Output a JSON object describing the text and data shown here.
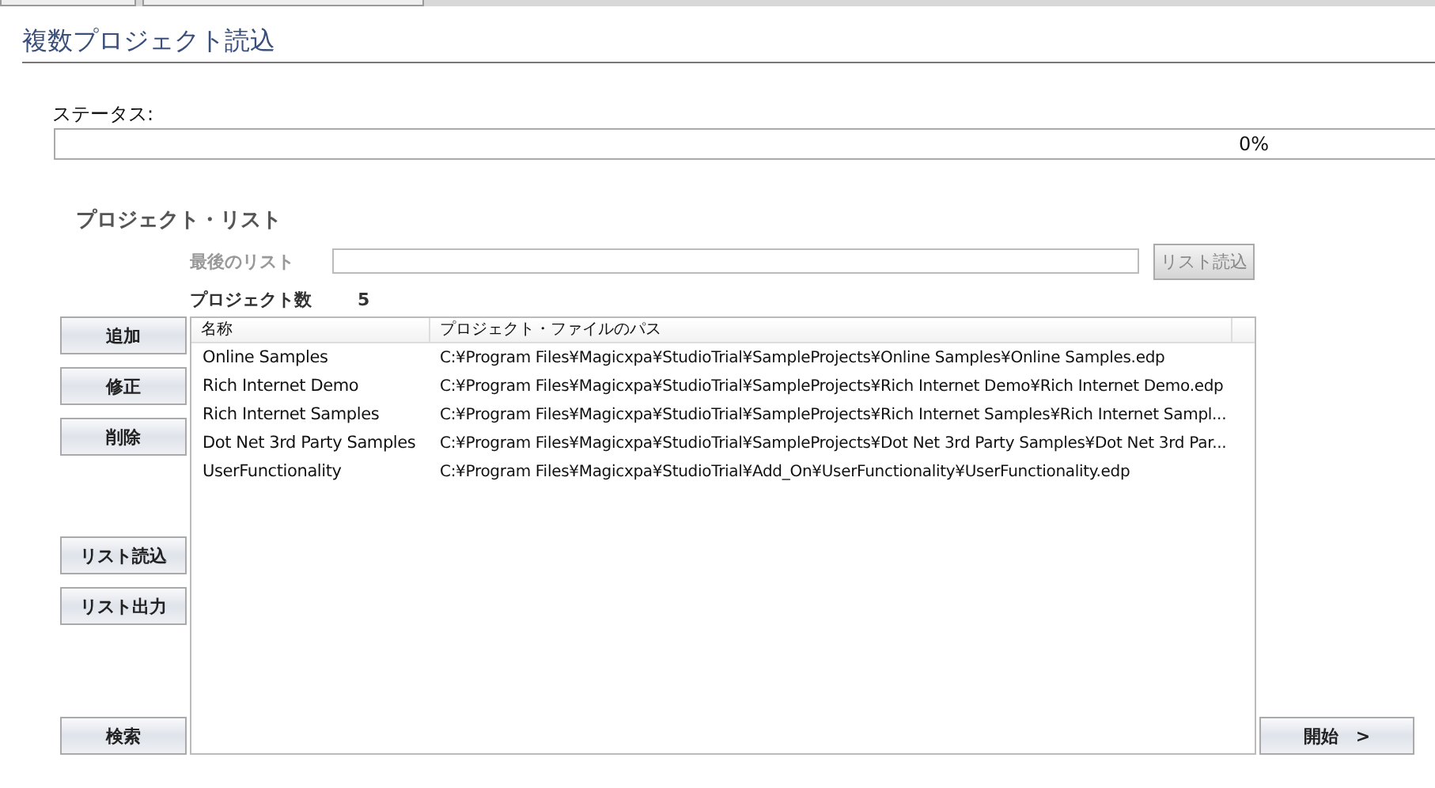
{
  "window": {
    "title": "複数プロジェクト読込"
  },
  "status": {
    "label": "ステータス:",
    "level": 0,
    "reading": "0%"
  },
  "project_list": {
    "title": "プロジェクト・リスト",
    "last_list": {
      "label": "最後のリスト",
      "disabled": true,
      "button": "リスト読込"
    },
    "count": {
      "label": "プロジェクト数",
      "value": "5"
    },
    "edit_buttons": [
      "追加",
      "修正",
      "削除"
    ],
    "list_buttons": [
      "リスト読込",
      "リスト出力"
    ],
    "search_button": "検索",
    "table": {
      "columns": [
        "名称",
        "プロジェクト・ファイルのパス"
      ],
      "rows": [
        {
          "name": "Online Samples",
          "path": "C:¥Program Files¥Magicxpa¥StudioTrial¥SampleProjects¥Online Samples¥Online Samples.edp"
        },
        {
          "name": "Rich Internet Demo",
          "path": "C:¥Program Files¥Magicxpa¥StudioTrial¥SampleProjects¥Rich Internet Demo¥Rich Internet Demo.edp"
        },
        {
          "name": "Rich Internet Samples",
          "path": "C:¥Program Files¥Magicxpa¥StudioTrial¥SampleProjects¥Rich Internet Samples¥Rich Internet Sampl..."
        },
        {
          "name": "Dot Net 3rd Party Samples",
          "path": "C:¥Program Files¥Magicxpa¥StudioTrial¥SampleProjects¥Dot Net 3rd Party Samples¥Dot Net 3rd Par..."
        },
        {
          "name": "UserFunctionality",
          "path": "C:¥Program Files¥Magicxpa¥StudioTrial¥Add_On¥UserFunctionality¥UserFunctionality.edp"
        }
      ]
    }
  },
  "start_button": "開始　>"
}
